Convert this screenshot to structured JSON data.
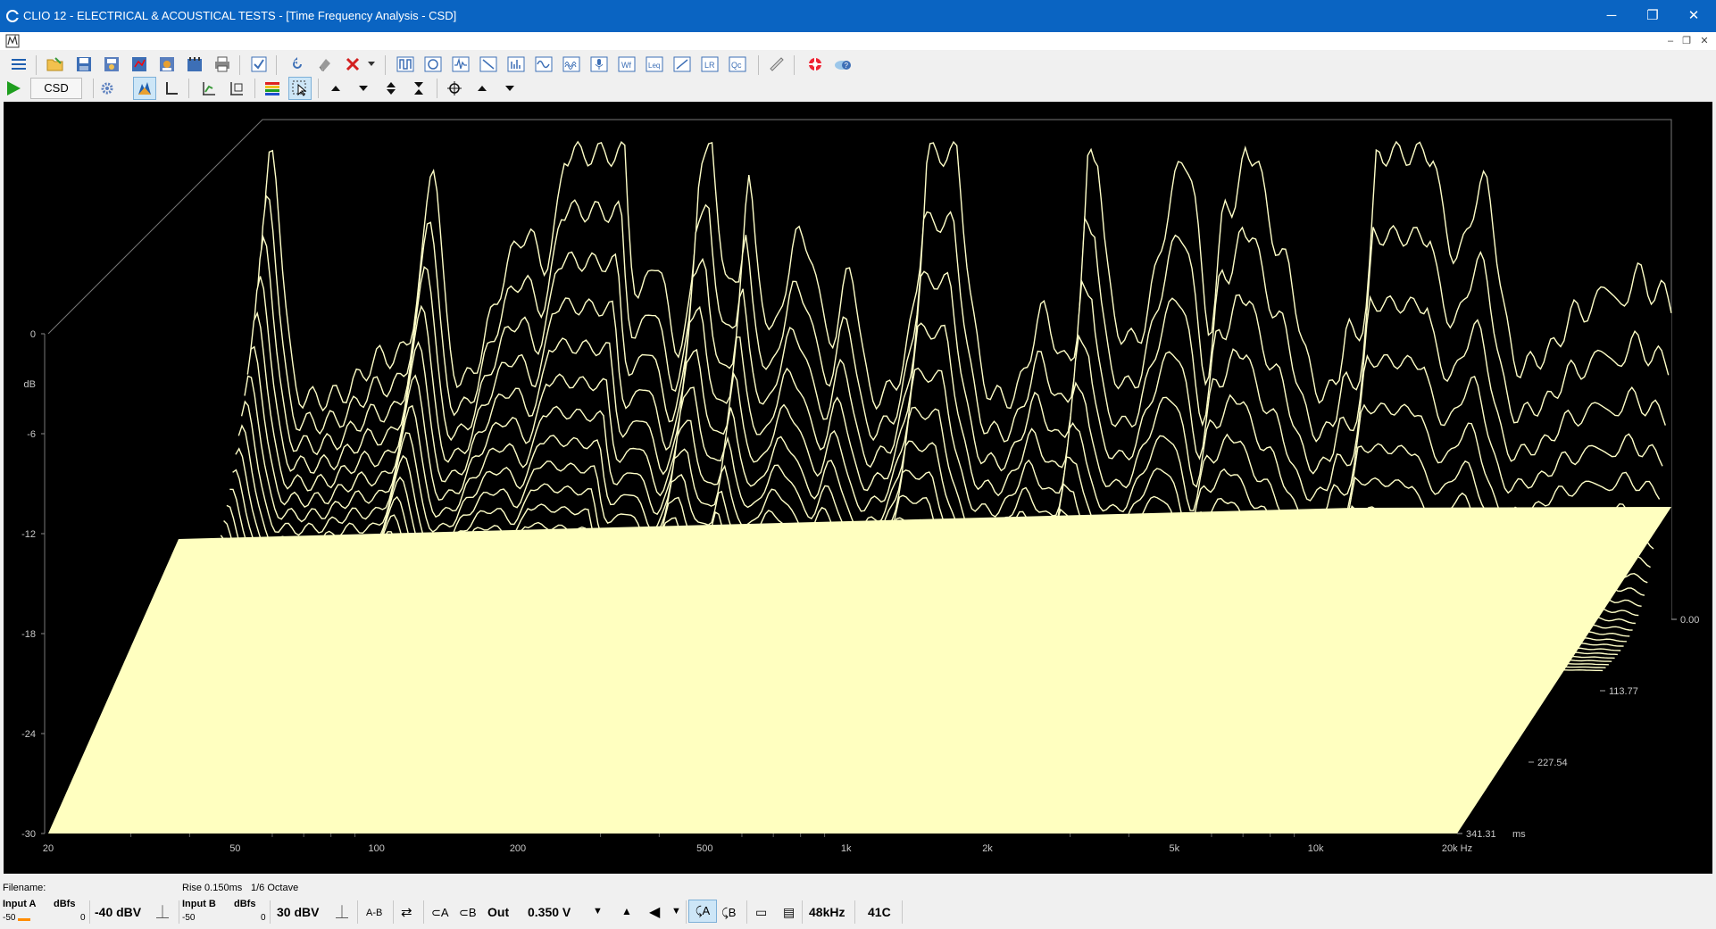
{
  "window": {
    "title": "CLIO 12 - ELECTRICAL & ACOUSTICAL TESTS - [Time Frequency Analysis - CSD]",
    "minimize": "─",
    "restore": "❐",
    "close": "✕",
    "mdi_min": "–",
    "mdi_restore": "❐",
    "mdi_close": "✕"
  },
  "toolbar2": {
    "mode_label": "CSD"
  },
  "graph": {
    "y_axis_unit": "dB",
    "y_ticks": [
      "0",
      "-6",
      "-12",
      "-18",
      "-24",
      "-30"
    ],
    "x_ticks": [
      "20",
      "50",
      "100",
      "200",
      "500",
      "1k",
      "2k",
      "5k",
      "10k",
      "20k Hz"
    ],
    "time_ticks": [
      "0.00",
      "113.77",
      "227.54",
      "341.31"
    ],
    "time_unit": "ms",
    "colors": {
      "background": "#000000",
      "trace": "#ffffc8",
      "floor": "#ffffc0"
    }
  },
  "status": {
    "filename_label": "Filename:",
    "rise_label": "Rise 0.150ms",
    "octave_label": "1/6 Octave",
    "input_a_label": "Input A",
    "input_a_unit": "dBfs",
    "input_a_min": "-50",
    "input_a_max": "0",
    "input_a_range": "-40 dBV",
    "input_b_label": "Input B",
    "input_b_unit": "dBfs",
    "input_b_min": "-50",
    "input_b_max": "0",
    "input_b_range": "30 dBV",
    "ab_label": "A-B",
    "out_label": "Out",
    "out_value": "0.350 V",
    "sample_rate": "48kHz",
    "temperature": "41C"
  }
}
